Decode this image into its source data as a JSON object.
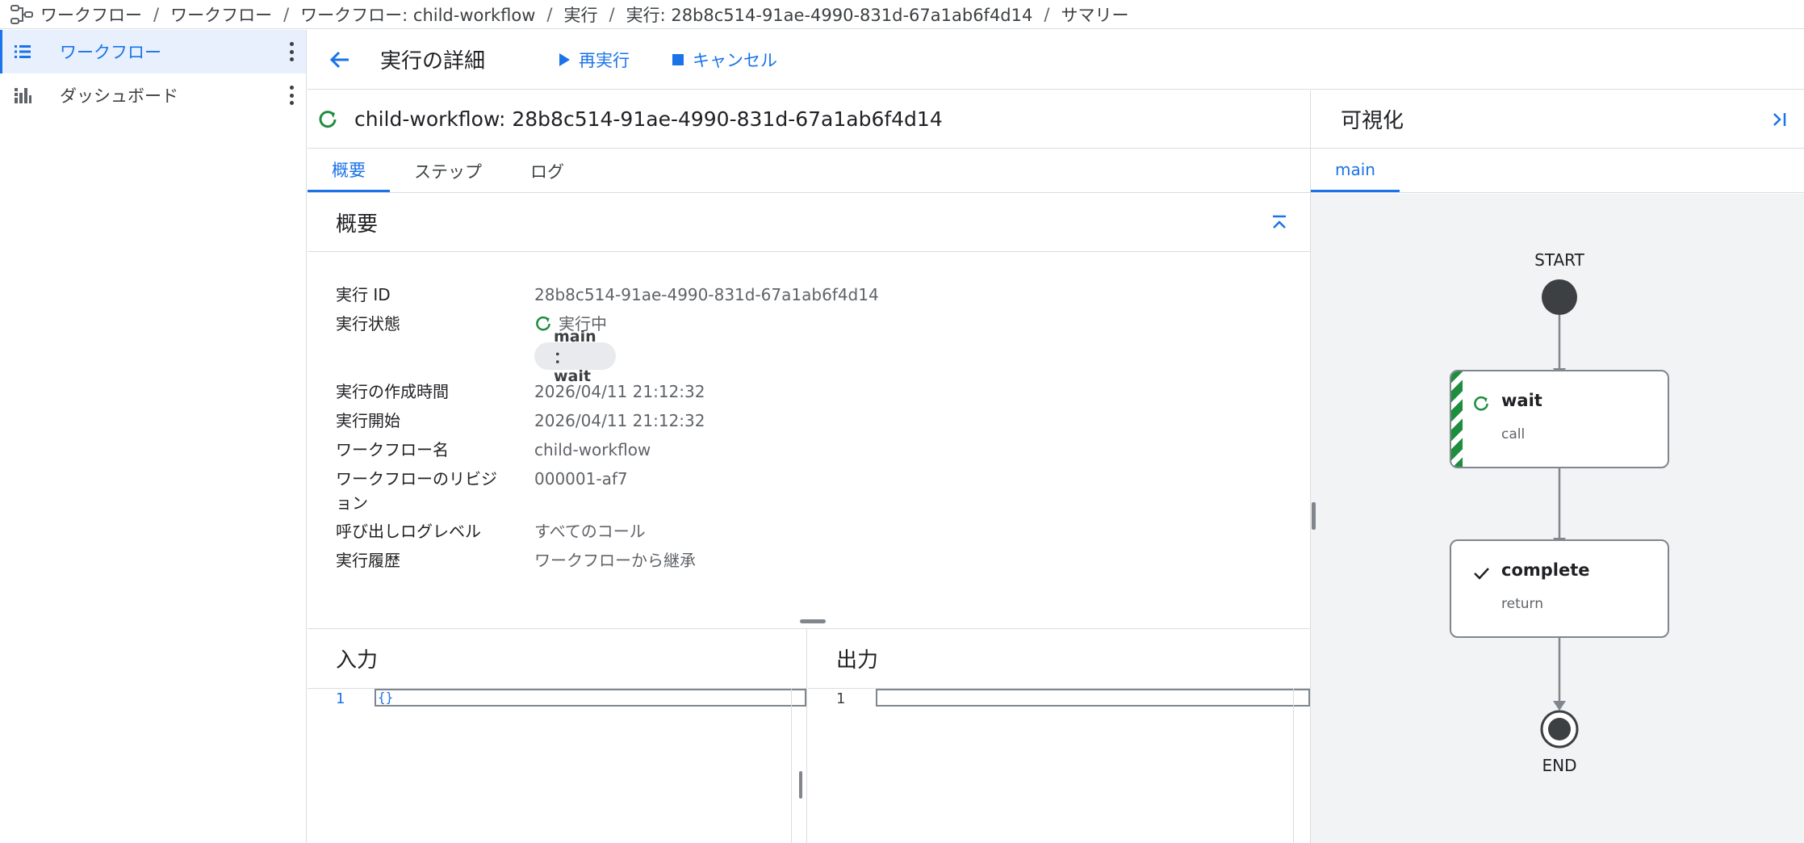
{
  "breadcrumb": {
    "items": [
      "ワークフロー",
      "ワークフロー",
      "ワークフロー: child-workflow",
      "実行",
      "実行: 28b8c514-91ae-4990-831d-67a1ab6f4d14",
      "サマリー"
    ],
    "separator": "/"
  },
  "nav": {
    "items": [
      {
        "label": "ワークフロー",
        "icon": "list-icon",
        "active": true
      },
      {
        "label": "ダッシュボード",
        "icon": "dashboard-icon",
        "active": false
      }
    ]
  },
  "toolbar": {
    "title": "実行の詳細",
    "rerun_label": "再実行",
    "cancel_label": "キャンセル"
  },
  "execution": {
    "header": "child-workflow: 28b8c514-91ae-4990-831d-67a1ab6f4d14"
  },
  "tabs": [
    "概要",
    "ステップ",
    "ログ"
  ],
  "overview": {
    "title": "概要",
    "rows": {
      "exec_id": {
        "label": "実行 ID",
        "value": "28b8c514-91ae-4990-831d-67a1ab6f4d14"
      },
      "state": {
        "label": "実行状態",
        "value": "実行中",
        "chip": "main ：wait"
      },
      "created": {
        "label": "実行の作成時間",
        "value": "2026/04/11 21:12:32"
      },
      "started": {
        "label": "実行開始",
        "value": "2026/04/11 21:12:32"
      },
      "workflow_name": {
        "label": "ワークフロー名",
        "value": "child-workflow"
      },
      "revision": {
        "label_line1": "ワークフローのリビジ",
        "label_line2": "ョン",
        "value": "000001-af7"
      },
      "log_level": {
        "label": "呼び出しログレベル",
        "value": "すべてのコール"
      },
      "history": {
        "label": "実行履歴",
        "value": "ワークフローから継承"
      }
    }
  },
  "input": {
    "title": "入力",
    "line_no": "1",
    "code": "{}"
  },
  "output": {
    "title": "出力",
    "line_no": "1",
    "code": ""
  },
  "visualization": {
    "title": "可視化",
    "tab": "main",
    "start_label": "START",
    "end_label": "END",
    "steps": [
      {
        "name": "wait",
        "type": "call",
        "status": "running"
      },
      {
        "name": "complete",
        "type": "return",
        "status": "done"
      }
    ]
  },
  "colors": {
    "accent": "#1a73e8",
    "running": "#1e8e3e",
    "border": "#dadce0"
  }
}
